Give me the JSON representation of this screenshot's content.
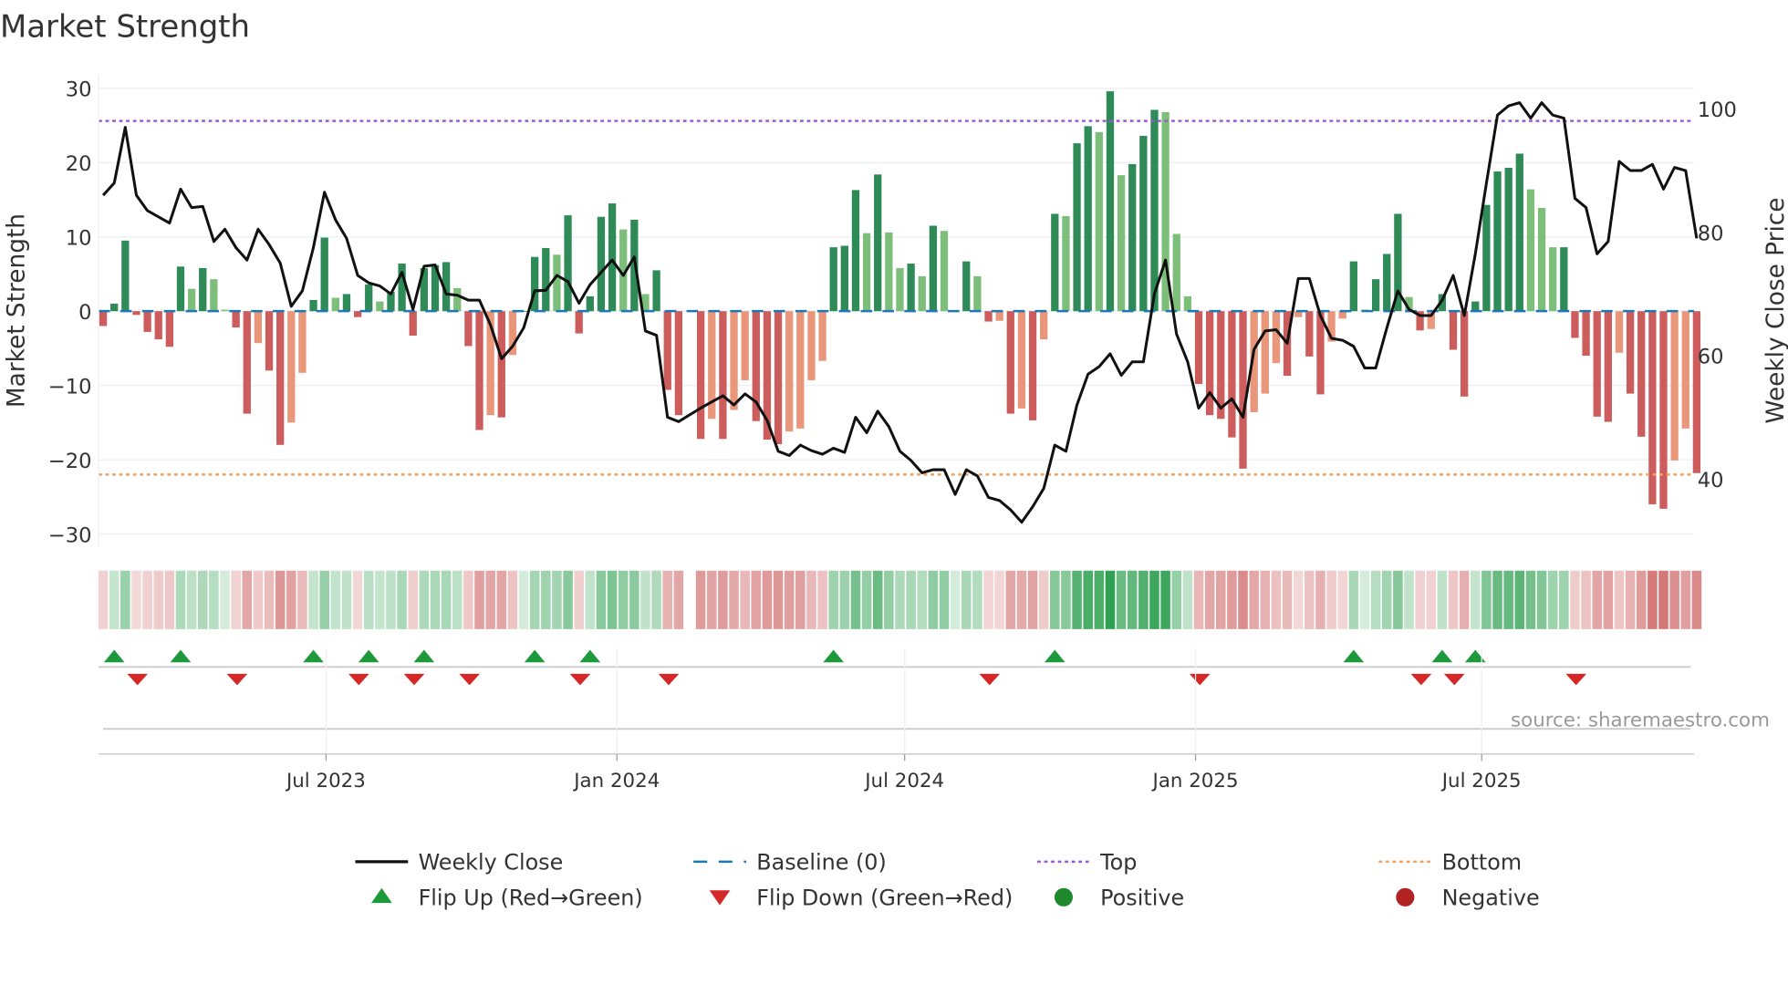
{
  "chart_data": {
    "type": "bar",
    "title": "Market Strength",
    "ylabel": "Market Strength",
    "y2label": "Weekly Close Price",
    "ylim": [
      -31,
      31
    ],
    "y2lim": [
      31.5,
      103
    ],
    "yticks": [
      30,
      20,
      10,
      0,
      -10,
      -20,
      -30
    ],
    "ytick_labels": [
      "30",
      "20",
      "10",
      "0",
      "−10",
      "−20",
      "−30"
    ],
    "y2ticks": [
      100,
      80,
      60,
      40
    ],
    "y2tick_labels": [
      "100",
      "80",
      "60",
      "40"
    ],
    "x_start": "2023-02-10",
    "x_step_days": 7,
    "xticks": [
      "2023-07-01",
      "2024-01-01",
      "2024-07-01",
      "2025-01-01",
      "2025-07-01"
    ],
    "xtick_labels": [
      "Jul 2023",
      "Jan 2024",
      "Jul 2024",
      "Jan 2025",
      "Jul 2025"
    ],
    "top_level": 25.6,
    "bottom_level": -22,
    "baseline": 0,
    "strength": [
      -2,
      1,
      9.5,
      -0.5,
      -2.8,
      -3.8,
      -4.8,
      6,
      3,
      5.8,
      4.3,
      0.2,
      -2.2,
      -13.8,
      -4.3,
      -8,
      -18,
      -15,
      -8.3,
      1.5,
      9.9,
      1.8,
      2.3,
      -0.8,
      3.6,
      1.3,
      2.6,
      6.4,
      -3.3,
      5.8,
      6.2,
      6.6,
      3.1,
      -4.7,
      -16,
      -14,
      -14.3,
      -5.9,
      0,
      7.3,
      8.5,
      7.6,
      12.9,
      -3,
      2,
      12.7,
      14.5,
      11,
      12.3,
      2.3,
      5.5,
      -10.6,
      -14,
      null,
      -17.2,
      -14.5,
      -17.2,
      -13.3,
      -9.3,
      -14.8,
      -17.3,
      -17.9,
      -16.2,
      -15.8,
      -9.3,
      -6.7,
      8.6,
      8.8,
      16.3,
      10.5,
      18.4,
      10.6,
      5.8,
      6.4,
      4.7,
      11.5,
      10.8,
      0,
      6.7,
      4.7,
      -1.4,
      -1.3,
      -13.8,
      -13.1,
      -14.7,
      -3.8,
      13.1,
      12.8,
      22.6,
      24.9,
      24.1,
      29.6,
      18.3,
      19.8,
      23.6,
      27.1,
      26.8,
      10.4,
      2,
      -9.8,
      -14,
      -14.5,
      -17,
      -21.2,
      -13.6,
      -11.1,
      -7,
      -8.7,
      -0.8,
      -6.1,
      -11.2,
      -4.1,
      -1,
      6.7,
      0.2,
      4.3,
      7.7,
      13.1,
      1.9,
      -2.6,
      -2.4,
      2.3,
      -5.2,
      -11.5,
      1.3,
      14.3,
      18.8,
      19.3,
      21.2,
      16.4,
      13.9,
      8.6,
      8.6,
      -3.6,
      -6,
      -14.2,
      -14.9,
      -5.6,
      -11.1,
      -16.9,
      -26,
      -26.6,
      -20.1,
      -15.8,
      -21.8
    ],
    "close": [
      86,
      88,
      97,
      86,
      83.5,
      82.5,
      81.5,
      87,
      84,
      84.2,
      78.5,
      80.5,
      77.5,
      75.5,
      80.5,
      78,
      75,
      68,
      70.5,
      77.5,
      86.5,
      82,
      79,
      73,
      71.8,
      71.3,
      70,
      73.5,
      67.5,
      74.5,
      74.7,
      70,
      69.8,
      69,
      69,
      65,
      59.5,
      61.5,
      64.5,
      70.5,
      70.6,
      73,
      72,
      68.5,
      71.5,
      73.5,
      75.5,
      73,
      76,
      64,
      63.3,
      50,
      49.3,
      50.4,
      51.5,
      52.5,
      53.5,
      52,
      53.8,
      52.5,
      49.5,
      44.5,
      43.8,
      45.5,
      44.6,
      44,
      45,
      44.3,
      50,
      47.5,
      51,
      48.5,
      44.5,
      43,
      41,
      41.5,
      41.5,
      37.5,
      41.5,
      40.5,
      37,
      36.5,
      35,
      33,
      35.5,
      38.5,
      45.5,
      44.5,
      52,
      57,
      58.2,
      60.3,
      56.8,
      59,
      59,
      70,
      75.5,
      63.5,
      59,
      51.5,
      54,
      51.5,
      53,
      50,
      61,
      64,
      64.2,
      62,
      72.5,
      72.5,
      66.5,
      62.8,
      62.5,
      61.5,
      58,
      58,
      64.5,
      70.5,
      67.5,
      66.5,
      66.5,
      69,
      73,
      66.5,
      76.5,
      88,
      99,
      100.5,
      101,
      98.5,
      101,
      99,
      98.5,
      85.5,
      84,
      76.5,
      78.5,
      91.5,
      90,
      90,
      91,
      87,
      90.5,
      90,
      79
    ],
    "flip_up_weeks": [
      1,
      7,
      19,
      24,
      29,
      39,
      44,
      66,
      86,
      113,
      121,
      124
    ],
    "flip_down_weeks": [
      3,
      12,
      23,
      28,
      33,
      43,
      51,
      80,
      99,
      119,
      122,
      133
    ],
    "legend": [
      {
        "label": "Weekly Close",
        "kind": "line",
        "color": "#111111"
      },
      {
        "label": "Baseline (0)",
        "kind": "dash",
        "color": "#1f77b4"
      },
      {
        "label": "Top",
        "kind": "dot",
        "color": "#9b59d0"
      },
      {
        "label": "Bottom",
        "kind": "dot",
        "color": "#f0a060"
      },
      {
        "label": "Flip Up (Red→Green)",
        "kind": "tri-up",
        "color": "#1e9a3c"
      },
      {
        "label": "Flip Down (Green→Red)",
        "kind": "tri-down",
        "color": "#d62728"
      },
      {
        "label": "Positive",
        "kind": "circle",
        "color": "#1e8a2c"
      },
      {
        "label": "Negative",
        "kind": "circle",
        "color": "#b22222"
      }
    ],
    "legend_placement": "bottom",
    "source": "source: sharemaestro.com"
  },
  "colors": {
    "pos_strong": "#2e8b57",
    "pos_weak": "#7dbf7a",
    "neg_strong": "#cd5c5c",
    "neg_weak": "#e9967a"
  }
}
